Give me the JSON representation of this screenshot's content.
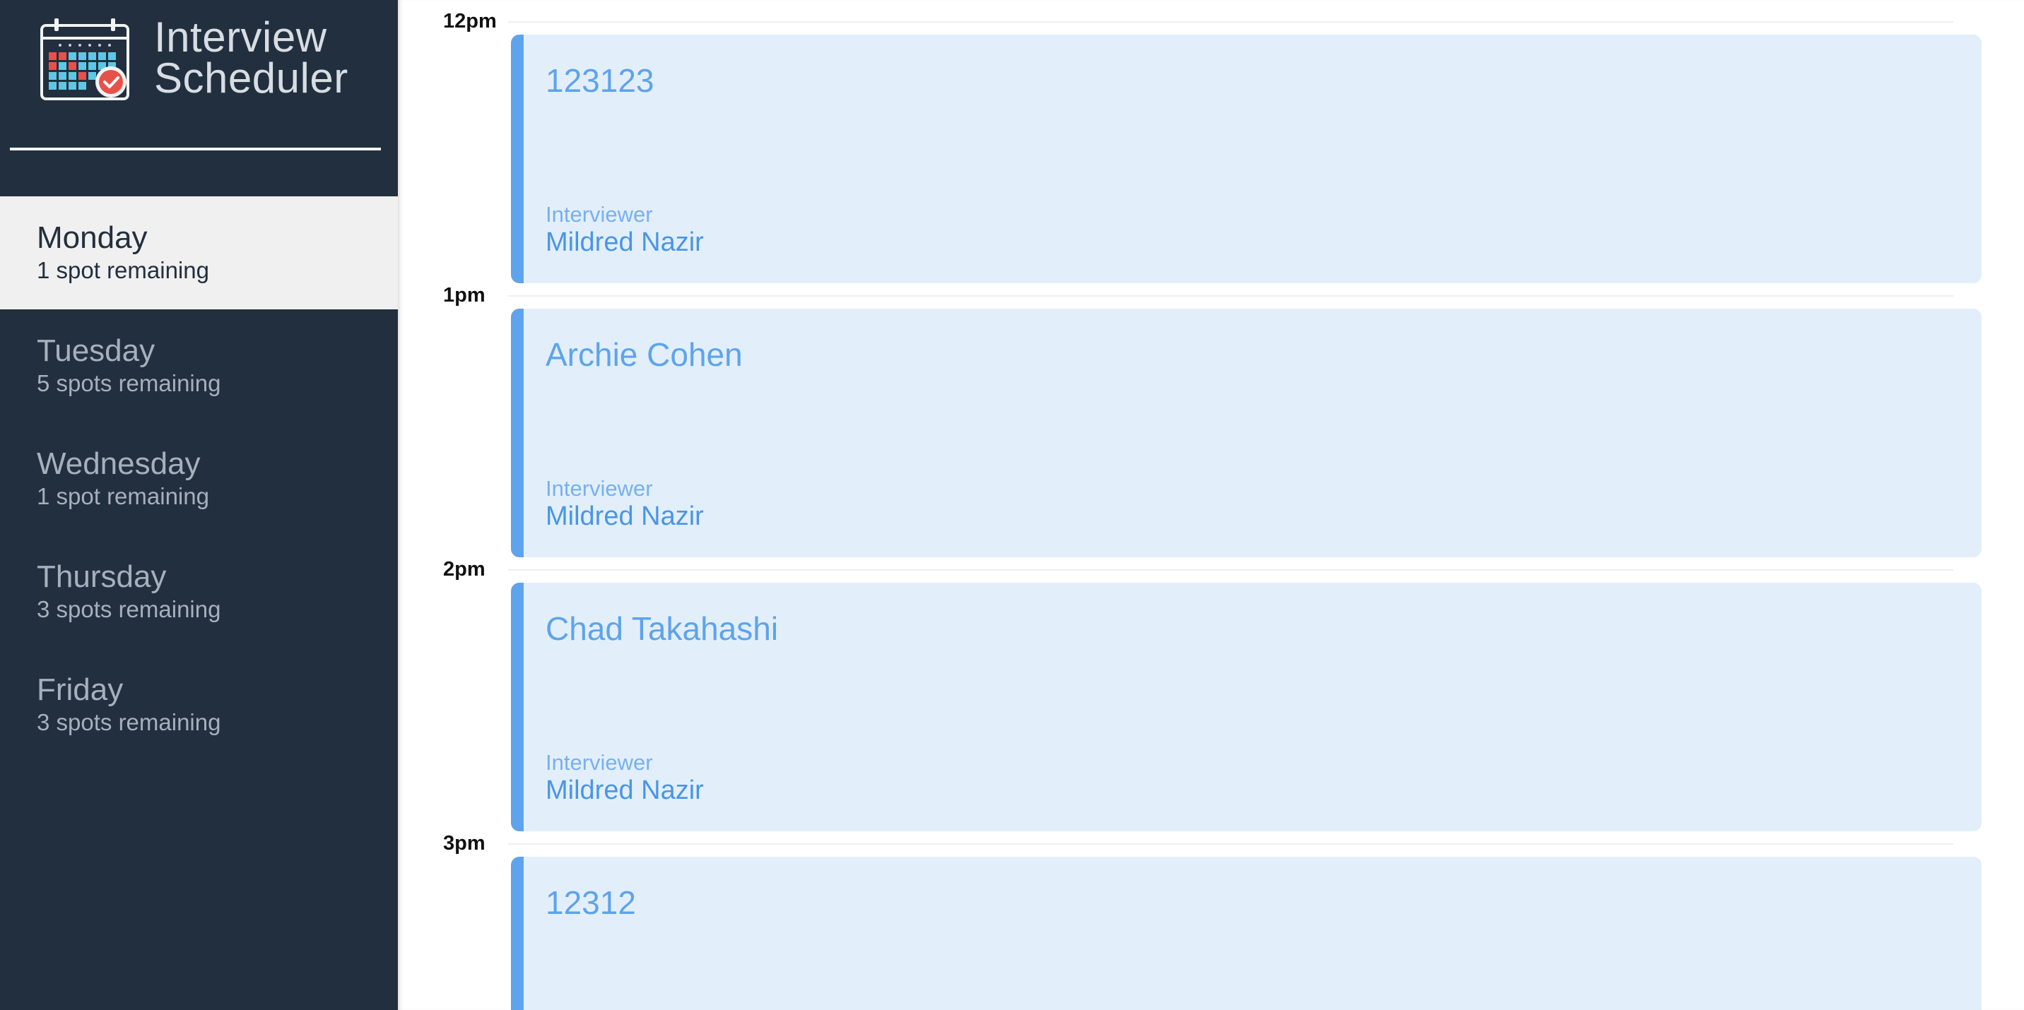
{
  "app": {
    "title_line1": "Interview",
    "title_line2": "Scheduler"
  },
  "colors": {
    "sidebar_bg": "#222f3e",
    "selected_bg": "#f0f0f0",
    "accent": "#5ea3ec",
    "card_bg": "#e2effb"
  },
  "days": [
    {
      "name": "Monday",
      "spots": "1 spot remaining",
      "selected": true
    },
    {
      "name": "Tuesday",
      "spots": "5 spots remaining",
      "selected": false
    },
    {
      "name": "Wednesday",
      "spots": "1 spot remaining",
      "selected": false
    },
    {
      "name": "Thursday",
      "spots": "3 spots remaining",
      "selected": false
    },
    {
      "name": "Friday",
      "spots": "3 spots remaining",
      "selected": false
    }
  ],
  "appointments": [
    {
      "time": "12pm",
      "student": "123123",
      "interviewer_label": "Interviewer",
      "interviewer": "Mildred Nazir"
    },
    {
      "time": "1pm",
      "student": "Archie Cohen",
      "interviewer_label": "Interviewer",
      "interviewer": "Mildred Nazir"
    },
    {
      "time": "2pm",
      "student": "Chad Takahashi",
      "interviewer_label": "Interviewer",
      "interviewer": "Mildred Nazir"
    },
    {
      "time": "3pm",
      "student": "12312",
      "interviewer_label": "",
      "interviewer": ""
    }
  ]
}
